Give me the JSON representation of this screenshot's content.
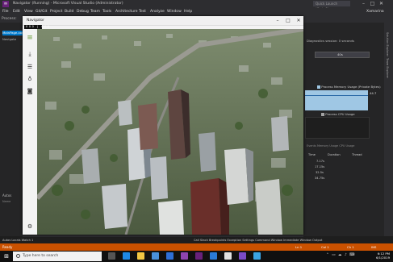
{
  "vs": {
    "title": "Navigator (Running) - Microsoft Visual Studio (Administrator)",
    "search_placeholder": "Quick Launch (Ctrl+Q)",
    "user": "Xamarina",
    "menu": [
      "File",
      "Edit",
      "View",
      "Git/Git",
      "Project",
      "Build",
      "Debug",
      "Team",
      "Tools",
      "Architecture",
      "Test",
      "Analyze",
      "Window",
      "Help"
    ],
    "diag_tab_label": "Process:",
    "left_tab_label": "MainPage.xaml",
    "left_nav_label": "Navigate",
    "left_autos_label": "Autos",
    "left_col_label": "Name",
    "left_bottom_label": "Autos   Locals   Watch 1",
    "right_tabs": [
      "Solution Explorer",
      "Team Explorer"
    ],
    "diag_time_label": "Diagnostics session: 0 seconds",
    "time_bar_label": "40s",
    "memory_legend": "Process Memory Usage (Private Bytes)",
    "memory_value": "44.7",
    "cpu_legend": "Process CPU Usage",
    "right_buttons": "Events   Memory Usage   CPU Usage",
    "events_headers": [
      "Time",
      "Duration",
      "Thread"
    ],
    "events_rows": [
      {
        "time": "7.17s"
      },
      {
        "time": "17.15s"
      },
      {
        "time": "32.5s"
      },
      {
        "time": "34.75s"
      }
    ],
    "bottom_tabs": "Call Stack   Breakpoints   Exception Settings   Command Window   Immediate Window   Output",
    "status": "Ready",
    "status_ln": "Ln 1",
    "status_col": "Col 1",
    "status_ch": "Ch 1",
    "status_ins": "INS",
    "accent_colors": {
      "status_bar": "#ca5100",
      "vs_accent": "#007acc",
      "memory_chart": "#9fc7e4"
    }
  },
  "app": {
    "title": "Navigator",
    "counter": "000 | 000",
    "sidebar_icons": [
      "hamburger-icon",
      "download-icon",
      "layers-icon",
      "pin-icon",
      "camera-icon",
      "settings-icon"
    ]
  },
  "taskbar": {
    "search_placeholder": "Type here to search",
    "time": "6:12 PM",
    "date": "6/1/2019",
    "apps": [
      "task-view",
      "edge",
      "explorer",
      "store",
      "mail",
      "visual-studio",
      "vscode",
      "github",
      "devices",
      "photos"
    ]
  }
}
